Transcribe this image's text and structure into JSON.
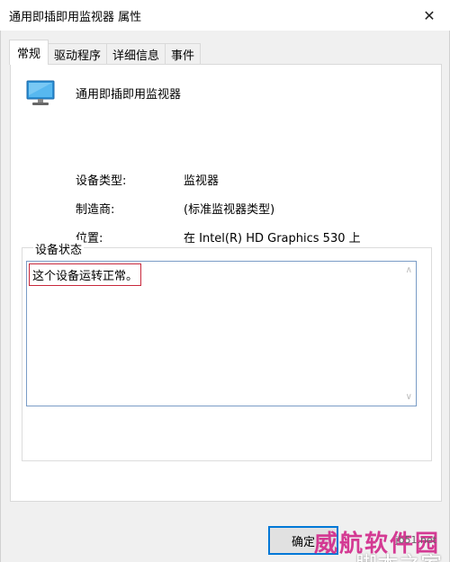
{
  "window": {
    "title": "通用即插即用监视器 属性",
    "close_glyph": "✕"
  },
  "tabs": [
    {
      "label": "常规",
      "active": true
    },
    {
      "label": "驱动程序",
      "active": false
    },
    {
      "label": "详细信息",
      "active": false
    },
    {
      "label": "事件",
      "active": false
    }
  ],
  "device": {
    "icon": "monitor-icon",
    "name": "通用即插即用监视器"
  },
  "properties": [
    {
      "label": "设备类型:",
      "value": "监视器"
    },
    {
      "label": "制造商:",
      "value": "(标准监视器类型)"
    },
    {
      "label": "位置:",
      "value": "在 Intel(R) HD Graphics 530 上"
    }
  ],
  "status": {
    "legend": "设备状态",
    "text": "这个设备运转正常。"
  },
  "buttons": {
    "ok": "确定"
  },
  "watermark": {
    "line1": "威航软件园",
    "line2": "jb51.net",
    "line3": "脚本之家"
  }
}
